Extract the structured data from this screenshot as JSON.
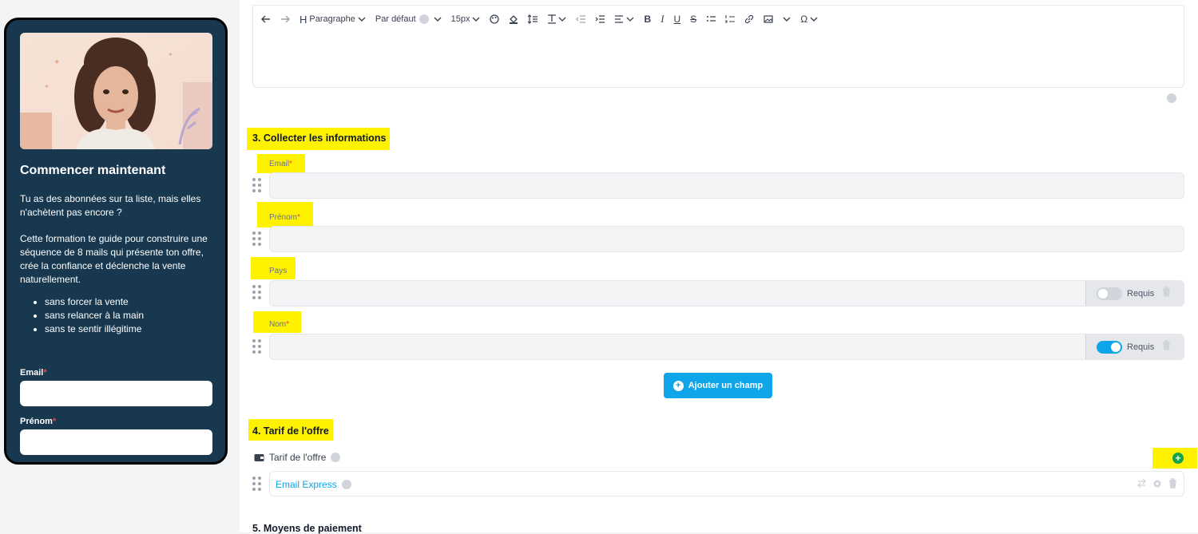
{
  "sidebar_card": {
    "title": "Commencer maintenant",
    "paragraph_1": "Tu as des abonnées sur ta liste, mais elles n'achètent pas encore ?",
    "paragraph_2": "Cette formation te guide pour construire une séquence de 8 mails qui présente ton offre, crée la confiance et déclenche la vente naturellement.",
    "bullets": [
      "sans forcer la vente",
      "sans relancer à la main",
      "sans te sentir illégitime"
    ],
    "email_label": "Email",
    "prenom_label": "Prénom",
    "required_mark": "*"
  },
  "toolbar": {
    "block_style": "Paragraphe",
    "font": "Par défaut",
    "font_size": "15px",
    "omega": "Ω"
  },
  "section3": {
    "title": "3. Collecter les informations",
    "fields": [
      {
        "label": "Email",
        "required_mark": "*"
      },
      {
        "label": "Prénom",
        "required_mark": "*"
      },
      {
        "label": "Pays",
        "required_mark": "",
        "requis_label": "Requis",
        "requis_on": false
      },
      {
        "label": "Nom",
        "required_mark": "*",
        "requis_label": "Requis",
        "requis_on": true
      }
    ],
    "add_button": "Ajouter un champ"
  },
  "section4": {
    "title": "4. Tarif de l'offre",
    "tarif_label": "Tarif de l'offre",
    "offer_name": "Email Express"
  },
  "section5": {
    "title": "5. Moyens de paiement"
  },
  "colors": {
    "card_bg": "#17384f",
    "accent": "#0ea5e9",
    "highlight": "#fff200",
    "success": "#16a34a"
  }
}
